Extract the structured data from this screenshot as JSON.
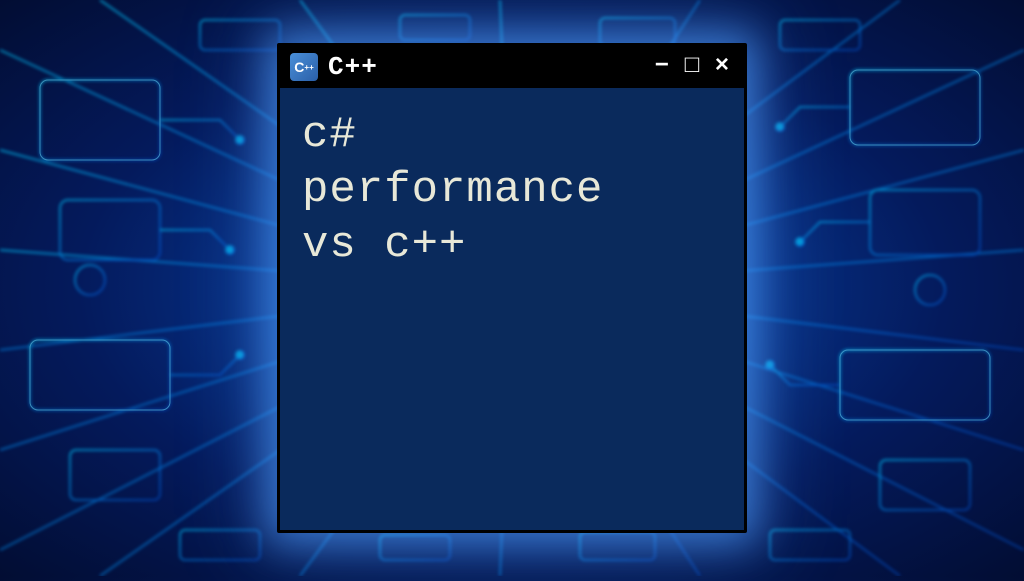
{
  "window": {
    "title": "C++",
    "icon_label": "C++",
    "controls": {
      "minimize": "−",
      "maximize": "□",
      "close": "×"
    }
  },
  "content": {
    "body_text": "c#\nperformance\nvs c++"
  },
  "colors": {
    "window_bg": "#0a2a5c",
    "titlebar_bg": "#000000",
    "text_color": "#e8e8d8",
    "glow": "#50a0ff"
  }
}
